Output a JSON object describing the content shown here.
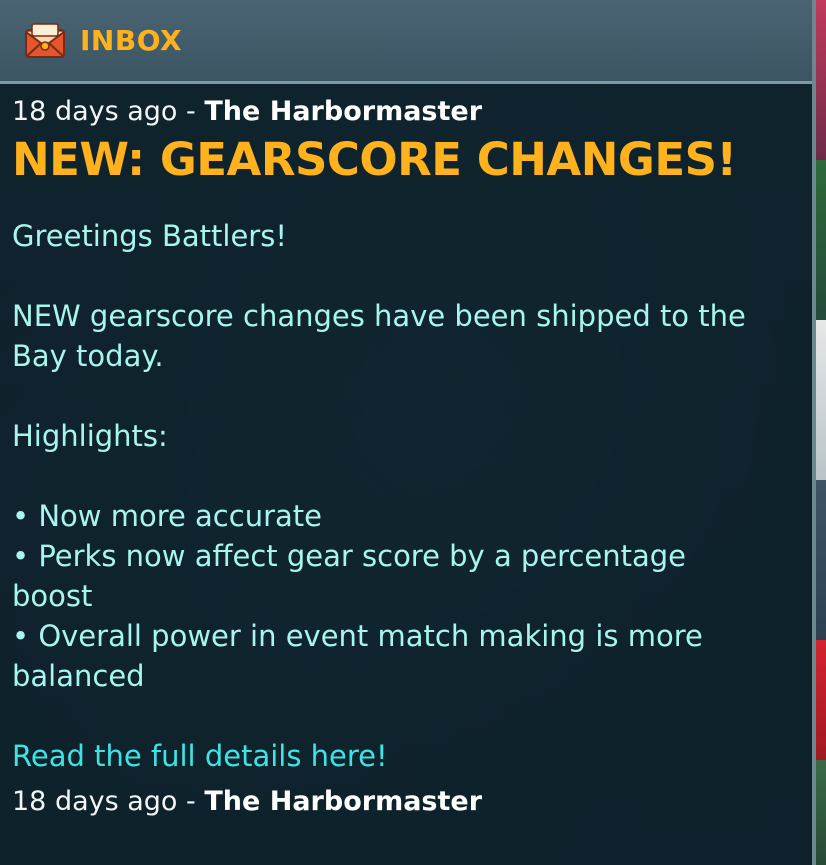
{
  "header": {
    "icon": "envelope-icon",
    "title": "INBOX"
  },
  "message": {
    "time": "18 days ago",
    "separator": " - ",
    "sender": "The Harbormaster",
    "headline": "NEW: GEARSCORE CHANGES!",
    "greeting": "Greetings Battlers!",
    "intro_line1": "NEW gearscore changes have been shipped to the",
    "intro_line2": "Bay today.",
    "highlights_label": "Highlights:",
    "bullets": [
      "• Now more accurate",
      "• Perks now affect gear score by a percentage",
      "boost",
      "• Overall power in event match making is more",
      "balanced"
    ],
    "link_text": "Read the full details here!"
  },
  "next_message": {
    "time": "18 days ago",
    "separator": " - ",
    "sender": "The Harbormaster"
  },
  "colors": {
    "accent": "#ffb21c",
    "body_text": "#a8f5ee",
    "link": "#3ee4e4",
    "header_bg": "#4a6473"
  }
}
